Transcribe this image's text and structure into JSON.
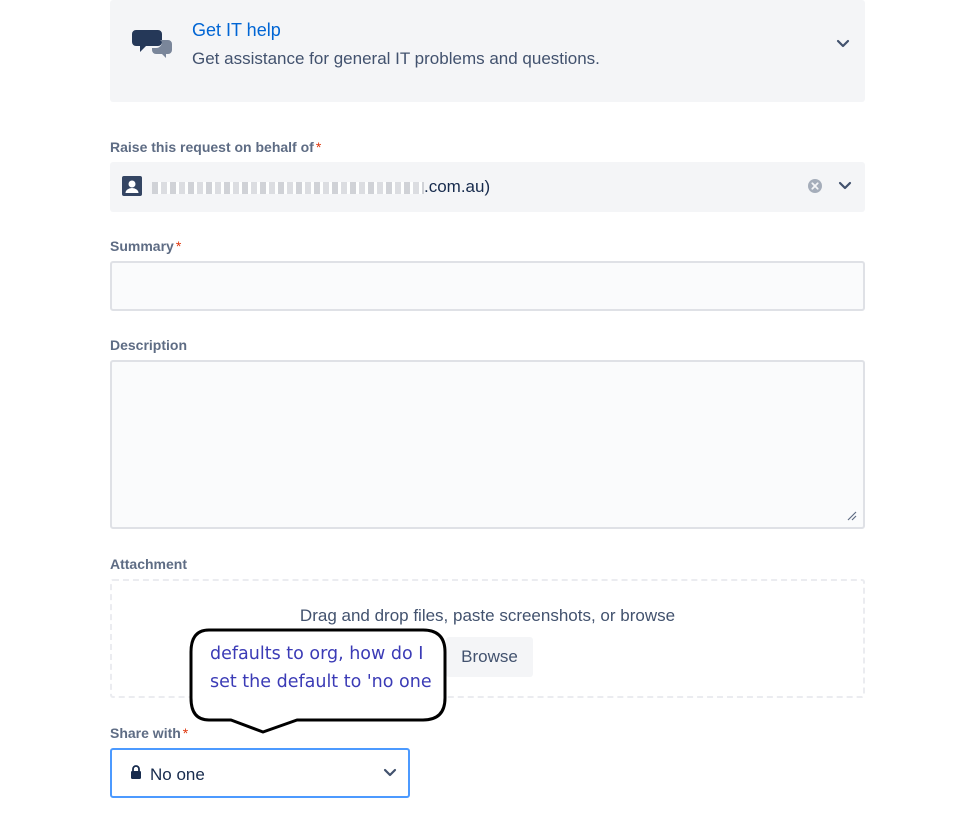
{
  "request_type": {
    "title": "Get IT help",
    "description": "Get assistance for general IT problems and questions.",
    "icon": "chat-bubbles-icon"
  },
  "behalf": {
    "label": "Raise this request on behalf of",
    "required_mark": "*",
    "value_suffix": ".com.au)"
  },
  "summary": {
    "label": "Summary",
    "required_mark": "*",
    "value": ""
  },
  "description": {
    "label": "Description",
    "value": ""
  },
  "attachment": {
    "label": "Attachment",
    "dropzone_text": "Drag and drop files, paste screenshots, or browse",
    "browse_label": "Browse"
  },
  "share_with": {
    "label": "Share with",
    "required_mark": "*",
    "value": "No one"
  },
  "annotation": {
    "lines": [
      "defaults to org, how do I",
      "set the default to 'no one"
    ]
  },
  "colors": {
    "link": "#0065d4",
    "required": "#de350b",
    "focus_border": "#4c9aff",
    "annotation_text": "#3b3bb6"
  }
}
